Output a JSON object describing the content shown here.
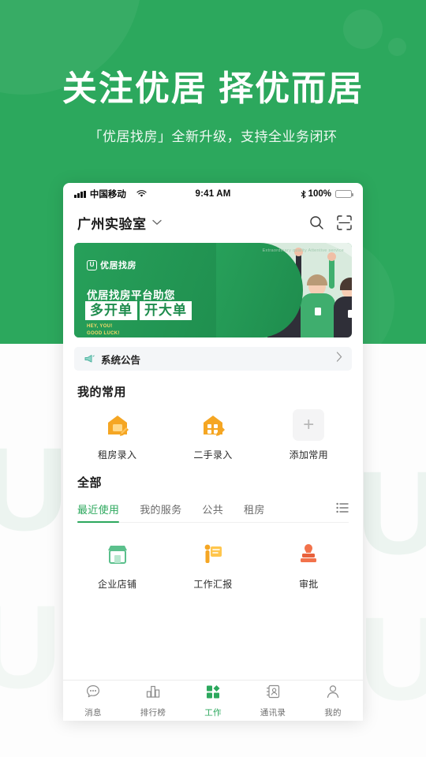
{
  "hero": {
    "title": "关注优居 择优而居",
    "subtitle": "「优居找房」全新升级，支持全业务闭环"
  },
  "theme": {
    "brand_green": "#2CA85D",
    "banner_green": "#1e8c4d",
    "accent_orange": "#F5A623",
    "accent_red": "#E8613C"
  },
  "phone": {
    "status_bar": {
      "carrier": "中国移动",
      "wifi_icon": "wifi-icon",
      "time": "9:41 AM",
      "bluetooth_icon": "bluetooth-icon",
      "battery_percent": "100%"
    },
    "app_bar": {
      "title": "广州实验室",
      "chevron_icon": "chevron-down-icon",
      "search_icon": "search-icon",
      "scan_icon": "scan-icon"
    },
    "banner": {
      "logo_mark": "U",
      "logo_text": "优居找房",
      "headline": "优居找房平台助您",
      "emphasis": [
        "多开单",
        "开大单"
      ],
      "footer_line1": "HEY, YOU!",
      "footer_line2": "GOOD LUCK!",
      "english_tag": "Extraordinary quality Attentive service"
    },
    "notice": {
      "icon": "megaphone-icon",
      "text": "系统公告",
      "chevron_icon": "chevron-right-icon"
    },
    "favorites": {
      "title": "我的常用",
      "items": [
        {
          "label": "租房录入",
          "icon": "house-rent-icon"
        },
        {
          "label": "二手录入",
          "icon": "house-resale-icon"
        },
        {
          "label": "添加常用",
          "icon": "plus-icon"
        }
      ]
    },
    "all": {
      "title": "全部",
      "tabs": [
        {
          "label": "最近使用",
          "active": true
        },
        {
          "label": "我的服务",
          "active": false
        },
        {
          "label": "公共",
          "active": false
        },
        {
          "label": "租房",
          "active": false
        }
      ],
      "list_icon": "list-view-icon",
      "apps": [
        {
          "label": "企业店铺",
          "icon": "shop-icon"
        },
        {
          "label": "工作汇报",
          "icon": "report-icon"
        },
        {
          "label": "审批",
          "icon": "stamp-approval-icon"
        }
      ]
    },
    "bottom_nav": [
      {
        "label": "消息",
        "icon": "chat-icon",
        "active": false
      },
      {
        "label": "排行榜",
        "icon": "ranking-icon",
        "active": false
      },
      {
        "label": "工作",
        "icon": "workspace-grid-icon",
        "active": true
      },
      {
        "label": "通讯录",
        "icon": "contacts-icon",
        "active": false
      },
      {
        "label": "我的",
        "icon": "profile-icon",
        "active": false
      }
    ]
  },
  "background": {
    "watermark_letter": "U"
  }
}
